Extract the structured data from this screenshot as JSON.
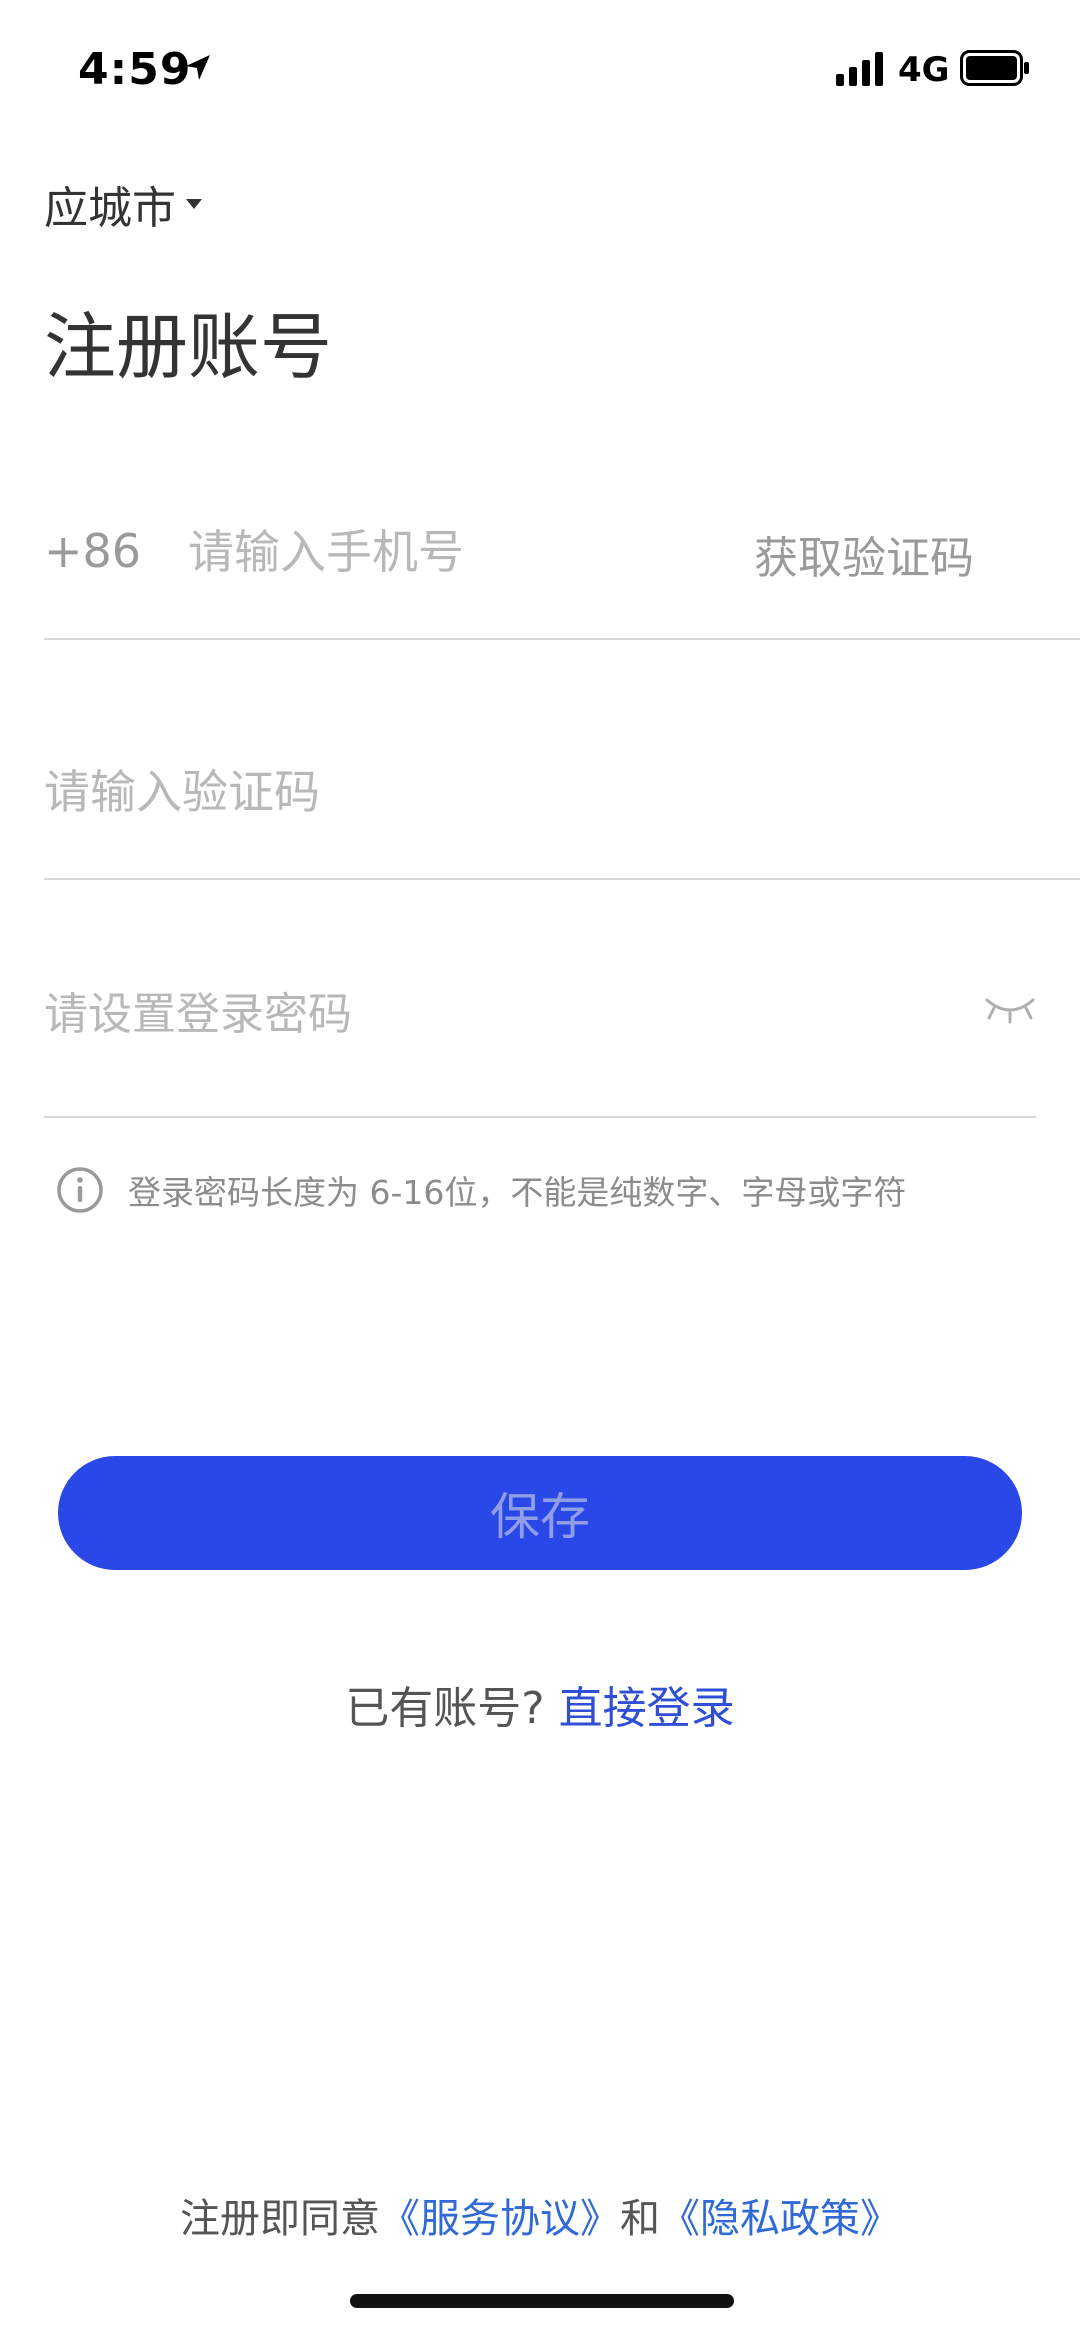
{
  "status_bar": {
    "time": "4:59",
    "network": "4G",
    "icons": [
      "location-arrow-icon",
      "signal-icon",
      "battery-icon"
    ]
  },
  "city_selector": {
    "label": "应城市",
    "icon": "caret-down-icon"
  },
  "page_title": "注册账号",
  "phone_field": {
    "country_code": "+86",
    "placeholder": "请输入手机号",
    "value": "",
    "get_code_label": "获取验证码"
  },
  "code_field": {
    "placeholder": "请输入验证码",
    "value": ""
  },
  "password_field": {
    "placeholder": "请设置登录密码",
    "value": "",
    "toggle_icon": "eye-closed-icon"
  },
  "hint": {
    "icon": "info-icon",
    "text": "登录密码长度为 6-16位，不能是纯数字、字母或字符"
  },
  "save_button": {
    "label": "保存"
  },
  "login": {
    "prompt": "已有账号?",
    "link": "直接登录"
  },
  "agreement": {
    "prefix": "注册即同意",
    "service_link": "《服务协议》",
    "and": "和",
    "privacy_link": "《隐私政策》"
  },
  "colors": {
    "primary": "#2a47e8",
    "link": "#2f4fd6",
    "placeholder": "#b8b8b8",
    "divider": "#d9d9d9"
  }
}
